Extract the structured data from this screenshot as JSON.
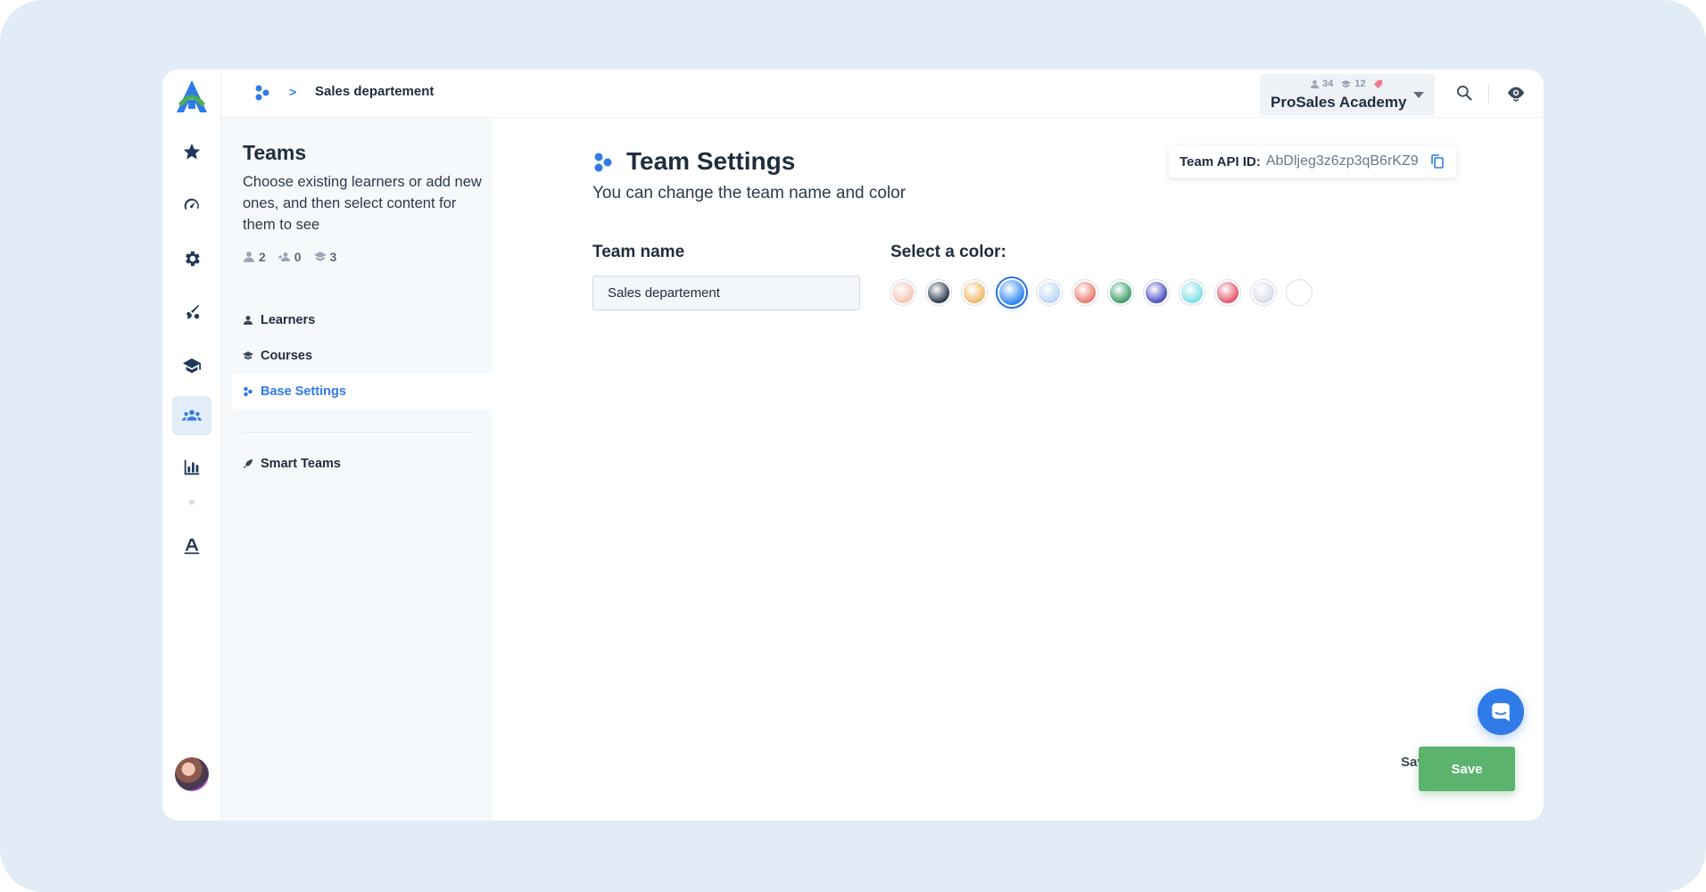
{
  "breadcrumb": {
    "separator": ">",
    "current": "Sales departement"
  },
  "academy": {
    "learners": "34",
    "courses": "12",
    "name": "ProSales Academy"
  },
  "panel": {
    "title": "Teams",
    "description": "Choose existing learners or add new ones, and then select content for them to see",
    "stats": {
      "learners": "2",
      "invited": "0",
      "courses": "3"
    },
    "nav": [
      {
        "label": "Learners"
      },
      {
        "label": "Courses"
      },
      {
        "label": "Base Settings"
      },
      {
        "label": "Smart Teams"
      }
    ]
  },
  "main": {
    "heading": "Team Settings",
    "subtitle": "You can change the team name and color",
    "api_label": "Team API ID:",
    "api_value": "AbDljeg3z6zp3qB6rKZ9",
    "team_name_label": "Team name",
    "team_name_value": "Sales departement",
    "color_label": "Select a color:",
    "colors": [
      "#f3c4b4",
      "#2e3b4e",
      "#f0b96a",
      "#2f86f0",
      "#b8d4f7",
      "#ee7a6e",
      "#3f9e6a",
      "#4a4fc4",
      "#7fe0e6",
      "#e2566a",
      "#d7dde8",
      "#ffffff"
    ],
    "selected_color_index": 3
  },
  "footer": {
    "save_exit_label": "Save & Exit",
    "save_label": "Save"
  },
  "accent": "#2f7be8"
}
